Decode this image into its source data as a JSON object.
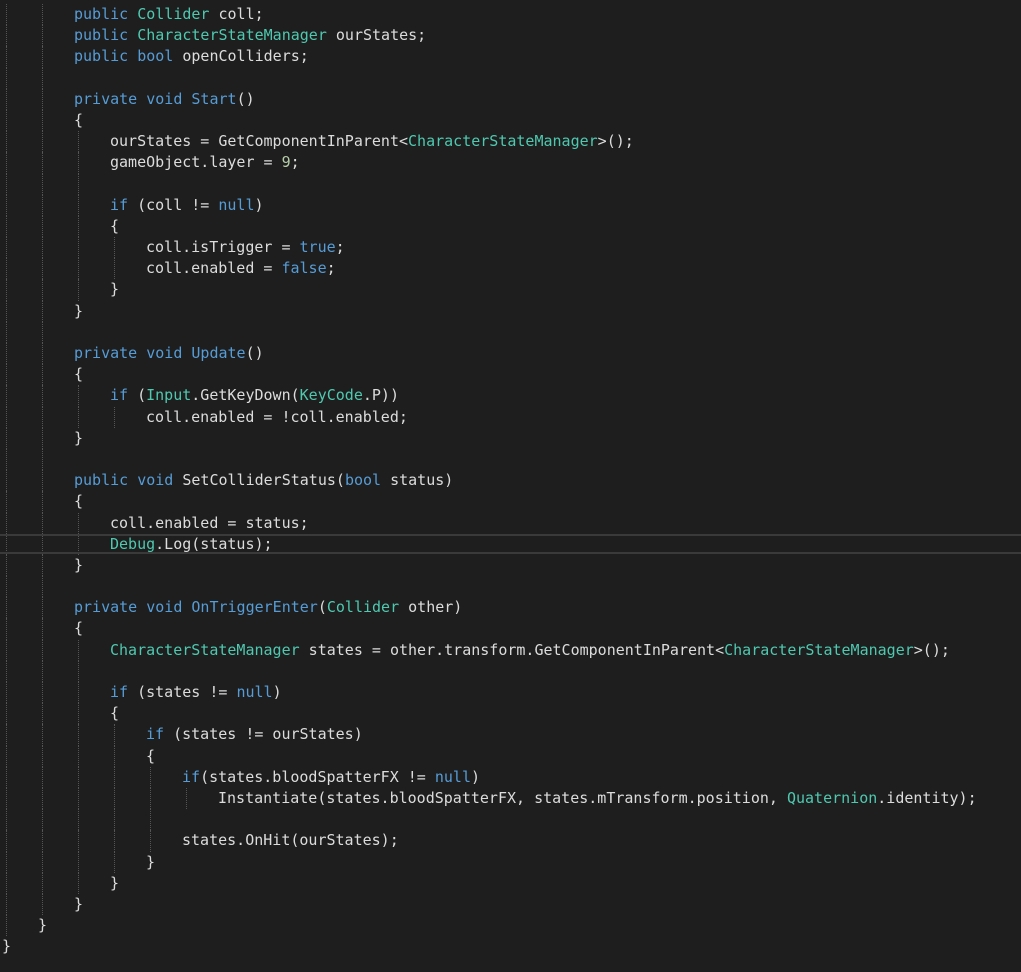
{
  "colors": {
    "background": "#1e1e1e",
    "keyword": "#569cd6",
    "type": "#4ec9b0",
    "text": "#dcdcdc",
    "number": "#b5cea8",
    "indent_guide": "#555555",
    "current_line_border": "#3a3a3a"
  },
  "current_line": 25,
  "lines": [
    {
      "indent": 2,
      "tokens": [
        [
          "kw",
          "public"
        ],
        [
          "plain",
          " "
        ],
        [
          "type",
          "Collider"
        ],
        [
          "plain",
          " coll;"
        ]
      ]
    },
    {
      "indent": 2,
      "tokens": [
        [
          "kw",
          "public"
        ],
        [
          "plain",
          " "
        ],
        [
          "type",
          "CharacterStateManager"
        ],
        [
          "plain",
          " ourStates;"
        ]
      ]
    },
    {
      "indent": 2,
      "tokens": [
        [
          "kw",
          "public"
        ],
        [
          "plain",
          " "
        ],
        [
          "kw",
          "bool"
        ],
        [
          "plain",
          " openColliders;"
        ]
      ]
    },
    {
      "indent": 2,
      "tokens": []
    },
    {
      "indent": 2,
      "tokens": [
        [
          "kw",
          "private"
        ],
        [
          "plain",
          " "
        ],
        [
          "kw",
          "void"
        ],
        [
          "plain",
          " "
        ],
        [
          "kw",
          "Start"
        ],
        [
          "plain",
          "()"
        ]
      ]
    },
    {
      "indent": 2,
      "tokens": [
        [
          "plain",
          "{"
        ]
      ]
    },
    {
      "indent": 3,
      "tokens": [
        [
          "plain",
          "ourStates = GetComponentInParent<"
        ],
        [
          "type",
          "CharacterStateManager"
        ],
        [
          "plain",
          ">();"
        ]
      ]
    },
    {
      "indent": 3,
      "tokens": [
        [
          "plain",
          "gameObject.layer = "
        ],
        [
          "num",
          "9"
        ],
        [
          "plain",
          ";"
        ]
      ]
    },
    {
      "indent": 3,
      "tokens": []
    },
    {
      "indent": 3,
      "tokens": [
        [
          "kw",
          "if"
        ],
        [
          "plain",
          " (coll != "
        ],
        [
          "kw",
          "null"
        ],
        [
          "plain",
          ")"
        ]
      ]
    },
    {
      "indent": 3,
      "tokens": [
        [
          "plain",
          "{"
        ]
      ]
    },
    {
      "indent": 4,
      "tokens": [
        [
          "plain",
          "coll.isTrigger = "
        ],
        [
          "kw",
          "true"
        ],
        [
          "plain",
          ";"
        ]
      ]
    },
    {
      "indent": 4,
      "tokens": [
        [
          "plain",
          "coll.enabled = "
        ],
        [
          "kw",
          "false"
        ],
        [
          "plain",
          ";"
        ]
      ]
    },
    {
      "indent": 3,
      "tokens": [
        [
          "plain",
          "}"
        ]
      ]
    },
    {
      "indent": 2,
      "tokens": [
        [
          "plain",
          "}"
        ]
      ]
    },
    {
      "indent": 2,
      "tokens": []
    },
    {
      "indent": 2,
      "tokens": [
        [
          "kw",
          "private"
        ],
        [
          "plain",
          " "
        ],
        [
          "kw",
          "void"
        ],
        [
          "plain",
          " "
        ],
        [
          "kw",
          "Update"
        ],
        [
          "plain",
          "()"
        ]
      ]
    },
    {
      "indent": 2,
      "tokens": [
        [
          "plain",
          "{"
        ]
      ]
    },
    {
      "indent": 3,
      "tokens": [
        [
          "kw",
          "if"
        ],
        [
          "plain",
          " ("
        ],
        [
          "type",
          "Input"
        ],
        [
          "plain",
          ".GetKeyDown("
        ],
        [
          "type",
          "KeyCode"
        ],
        [
          "plain",
          ".P))"
        ]
      ]
    },
    {
      "indent": 4,
      "tokens": [
        [
          "plain",
          "coll.enabled = !coll.enabled;"
        ]
      ]
    },
    {
      "indent": 2,
      "tokens": [
        [
          "plain",
          "}"
        ]
      ]
    },
    {
      "indent": 2,
      "tokens": []
    },
    {
      "indent": 2,
      "tokens": [
        [
          "kw",
          "public"
        ],
        [
          "plain",
          " "
        ],
        [
          "kw",
          "void"
        ],
        [
          "plain",
          " SetColliderStatus("
        ],
        [
          "kw",
          "bool"
        ],
        [
          "plain",
          " status)"
        ]
      ]
    },
    {
      "indent": 2,
      "tokens": [
        [
          "plain",
          "{"
        ]
      ]
    },
    {
      "indent": 3,
      "tokens": [
        [
          "plain",
          "coll.enabled = status;"
        ]
      ]
    },
    {
      "indent": 3,
      "tokens": [
        [
          "type",
          "Debug"
        ],
        [
          "plain",
          ".Log(status);"
        ]
      ]
    },
    {
      "indent": 2,
      "tokens": [
        [
          "plain",
          "}"
        ]
      ]
    },
    {
      "indent": 2,
      "tokens": []
    },
    {
      "indent": 2,
      "tokens": [
        [
          "kw",
          "private"
        ],
        [
          "plain",
          " "
        ],
        [
          "kw",
          "void"
        ],
        [
          "plain",
          " "
        ],
        [
          "kw",
          "OnTriggerEnter"
        ],
        [
          "plain",
          "("
        ],
        [
          "type",
          "Collider"
        ],
        [
          "plain",
          " other)"
        ]
      ]
    },
    {
      "indent": 2,
      "tokens": [
        [
          "plain",
          "{"
        ]
      ]
    },
    {
      "indent": 3,
      "tokens": [
        [
          "type",
          "CharacterStateManager"
        ],
        [
          "plain",
          " states = other.transform.GetComponentInParent<"
        ],
        [
          "type",
          "CharacterStateManager"
        ],
        [
          "plain",
          ">();"
        ]
      ]
    },
    {
      "indent": 3,
      "tokens": []
    },
    {
      "indent": 3,
      "tokens": [
        [
          "kw",
          "if"
        ],
        [
          "plain",
          " (states != "
        ],
        [
          "kw",
          "null"
        ],
        [
          "plain",
          ")"
        ]
      ]
    },
    {
      "indent": 3,
      "tokens": [
        [
          "plain",
          "{"
        ]
      ]
    },
    {
      "indent": 4,
      "tokens": [
        [
          "kw",
          "if"
        ],
        [
          "plain",
          " (states != ourStates)"
        ]
      ]
    },
    {
      "indent": 4,
      "tokens": [
        [
          "plain",
          "{"
        ]
      ]
    },
    {
      "indent": 5,
      "tokens": [
        [
          "kw",
          "if"
        ],
        [
          "plain",
          "(states.bloodSpatterFX != "
        ],
        [
          "kw",
          "null"
        ],
        [
          "plain",
          ")"
        ]
      ]
    },
    {
      "indent": 6,
      "tokens": [
        [
          "plain",
          "Instantiate(states.bloodSpatterFX, states.mTransform.position, "
        ],
        [
          "type",
          "Quaternion"
        ],
        [
          "plain",
          ".identity);"
        ]
      ]
    },
    {
      "indent": 5,
      "tokens": []
    },
    {
      "indent": 5,
      "tokens": [
        [
          "plain",
          "states.OnHit(ourStates);"
        ]
      ]
    },
    {
      "indent": 4,
      "tokens": [
        [
          "plain",
          "}"
        ]
      ]
    },
    {
      "indent": 3,
      "tokens": [
        [
          "plain",
          "}"
        ]
      ]
    },
    {
      "indent": 2,
      "tokens": [
        [
          "plain",
          "}"
        ]
      ]
    },
    {
      "indent": 1,
      "tokens": [
        [
          "plain",
          "}"
        ]
      ]
    },
    {
      "indent": 0,
      "tokens": [
        [
          "plain",
          "}"
        ]
      ]
    }
  ]
}
